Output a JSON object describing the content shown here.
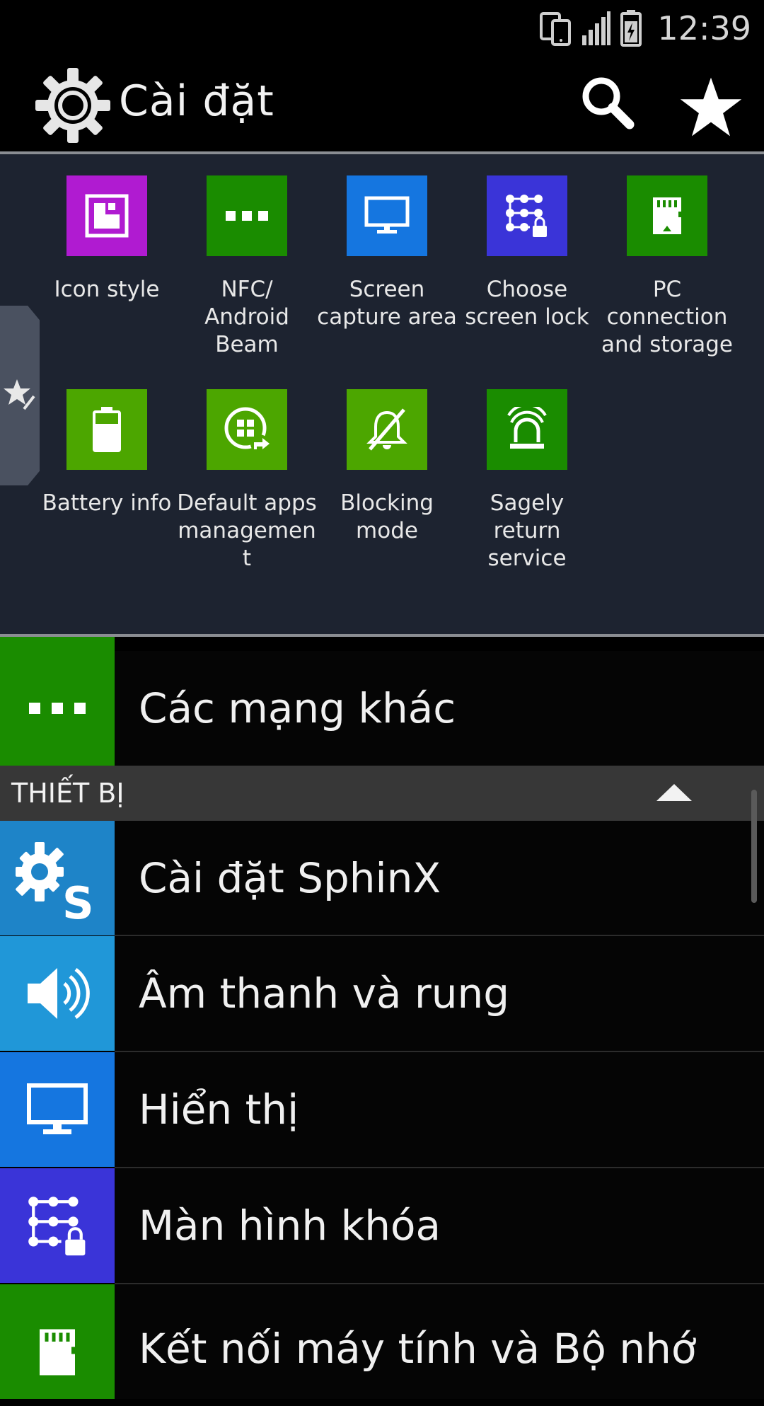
{
  "status_bar": {
    "time": "12:39"
  },
  "app_bar": {
    "title": "Cài đặt"
  },
  "quick_settings": [
    {
      "label": "Icon style",
      "color": "#b01bd1",
      "icon": "icon-style-icon"
    },
    {
      "label": "NFC/ Android Beam",
      "color": "#1a8c00",
      "icon": "more-dots-icon"
    },
    {
      "label": "Screen capture area",
      "color": "#1576e0",
      "icon": "monitor-icon"
    },
    {
      "label": "Choose screen lock",
      "color": "#3a34d8",
      "icon": "pattern-lock-icon"
    },
    {
      "label": "PC connection and storage",
      "color": "#1a8c00",
      "icon": "sd-card-icon"
    },
    {
      "label": "Battery info",
      "color": "#4ca600",
      "icon": "battery-icon"
    },
    {
      "label": "Default apps managemen t",
      "color": "#4ca600",
      "icon": "default-apps-icon"
    },
    {
      "label": "Blocking mode",
      "color": "#4ca600",
      "icon": "bell-off-icon"
    },
    {
      "label": "Sagely return service",
      "color": "#1a8c00",
      "icon": "siren-icon"
    }
  ],
  "list": {
    "other_networks": {
      "label": "Các mạng khác",
      "color": "#1a8c00"
    },
    "section_header": "THIẾT BỊ",
    "items": [
      {
        "label": "Cài đặt SphinX",
        "color": "#1e84c8",
        "icon": "sphinx-settings-icon"
      },
      {
        "label": "Âm thanh và rung",
        "color": "#2097d8",
        "icon": "speaker-icon"
      },
      {
        "label": "Hiển thị",
        "color": "#1576e0",
        "icon": "monitor-icon"
      },
      {
        "label": "Màn hình khóa",
        "color": "#3a34d8",
        "icon": "pattern-lock-icon"
      },
      {
        "label": "Kết nối máy tính và Bộ nhớ",
        "color": "#1a8c00",
        "icon": "sd-card-icon"
      }
    ]
  }
}
